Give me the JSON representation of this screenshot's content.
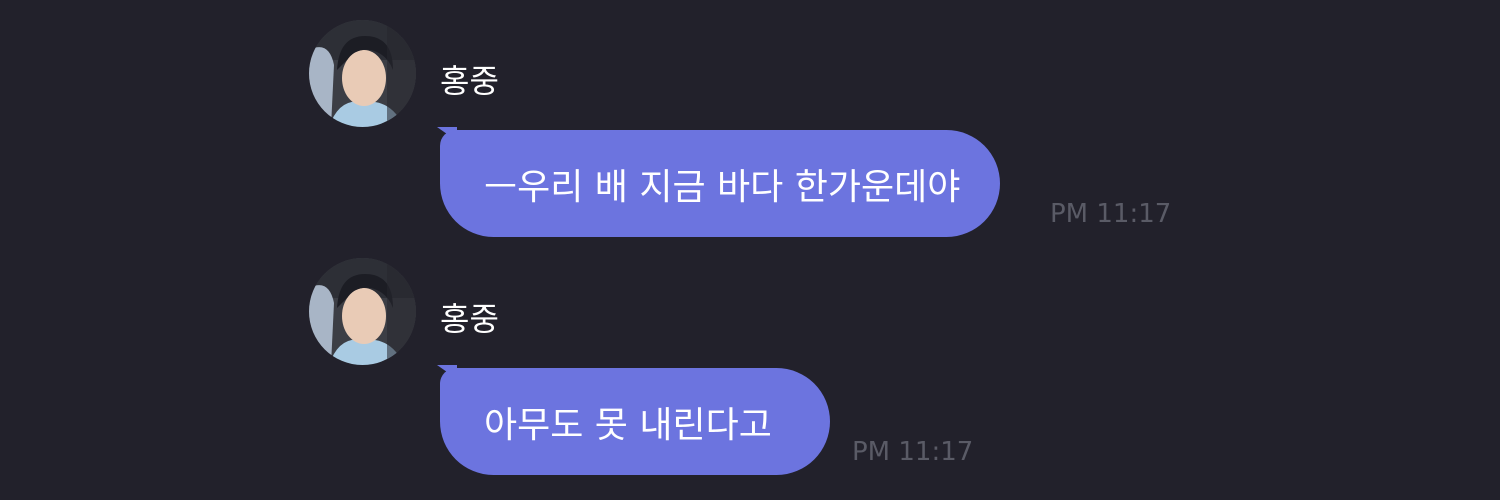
{
  "conversation": {
    "messages": [
      {
        "sender": "홍중",
        "avatar": "profile-photo",
        "text": "ㅡ우리 배 지금 바다 한가운데야",
        "time": "PM 11:17"
      },
      {
        "sender": "홍중",
        "avatar": "profile-photo",
        "text": "아무도 못 내린다고",
        "time": "PM 11:17"
      }
    ]
  },
  "colors": {
    "background": "#22212b",
    "bubble": "#6c74df",
    "bubble_text": "#ffffff",
    "sender_name": "#ffffff",
    "timestamp": "#5a5b66"
  }
}
